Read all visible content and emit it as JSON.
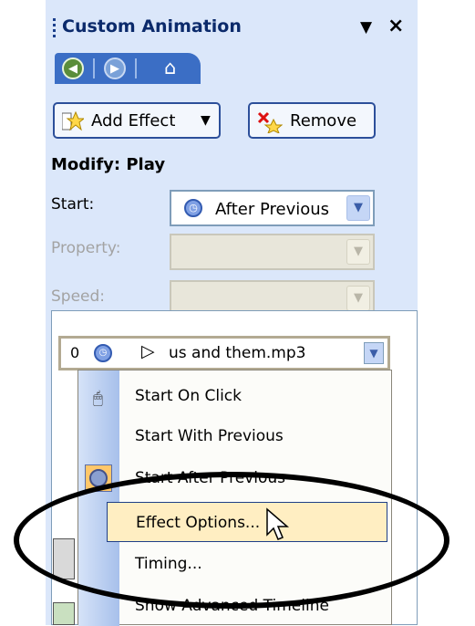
{
  "title_bar": {
    "title": "Custom Animation",
    "menu_arrow": "▼",
    "close": "×"
  },
  "nav": {
    "back_icon": "back-icon",
    "forward_icon": "forward-icon",
    "home_icon": "home-icon",
    "home_glyph": "⌂"
  },
  "toolbar": {
    "add_effect_label": "Add Effect",
    "add_effect_arrow": "▼",
    "remove_label": "Remove"
  },
  "modify": {
    "heading": "Modify: Play"
  },
  "fields": {
    "start_label": "Start:",
    "start_value": "After Previous",
    "property_label": "Property:",
    "speed_label": "Speed:"
  },
  "effect_list": {
    "item": {
      "order": "0",
      "name": "us and them.mp3",
      "play_glyph": "▷"
    }
  },
  "context_menu": {
    "items": [
      {
        "label": "Start On Click"
      },
      {
        "label": "Start With Previous"
      },
      {
        "label": "Start After Previous"
      },
      {
        "label": "Effect Options..."
      },
      {
        "label": "Timing..."
      },
      {
        "label": "Show Advanced Timeline"
      }
    ]
  },
  "colors": {
    "panel_bg": "#dbe7fa",
    "nav_bar": "#3b6ec5",
    "highlight": "#ffeec2",
    "title_text": "#0b2a6b"
  }
}
